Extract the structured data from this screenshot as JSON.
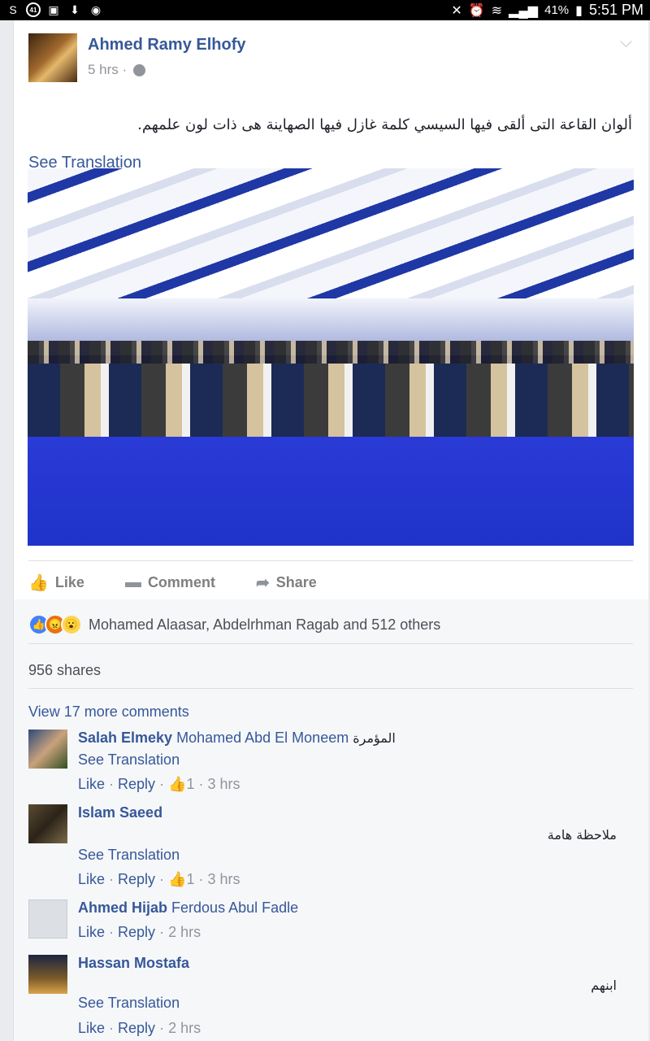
{
  "status_bar": {
    "left_icons": [
      "skype-icon",
      "notification-41-icon",
      "gallery-icon",
      "download-icon",
      "messenger-icon"
    ],
    "badge_text": "41",
    "battery": "41%",
    "time": "5:51 PM"
  },
  "post": {
    "author": "Ahmed Ramy Elhofy",
    "time": "5 hrs ·",
    "text": "ألوان القاعة التى ألقى فيها السيسي كلمة غازل فيها الصهاينة هى ذات لون علمهم.",
    "see_translation": "See Translation",
    "actions": {
      "like": "Like",
      "comment": "Comment",
      "share": "Share"
    }
  },
  "reactions": {
    "summary": "Mohamed Alaasar, Abdelrhman Ragab and 512 others",
    "shares": "956 shares",
    "view_more": "View 17 more comments"
  },
  "comments": [
    {
      "name": "Salah Elmeky",
      "tag": "Mohamed Abd El Moneem",
      "text_inline": "المؤمرة",
      "see_translation": "See Translation",
      "like": "Like",
      "reply": "Reply",
      "likes": "1",
      "time": "3 hrs"
    },
    {
      "name": "Islam Saeed",
      "text": "ملاحظة هامة",
      "see_translation": "See Translation",
      "like": "Like",
      "reply": "Reply",
      "likes": "1",
      "time": "3 hrs"
    },
    {
      "name": "Ahmed Hijab",
      "tag": "Ferdous Abul Fadle",
      "like": "Like",
      "reply": "Reply",
      "time": "2 hrs"
    },
    {
      "name": "Hassan Mostafa",
      "text": "ابنهم",
      "see_translation": "See Translation",
      "like": "Like",
      "reply": "Reply",
      "time": "2 hrs"
    }
  ],
  "colors": {
    "link": "#365899",
    "muted": "#90949c",
    "background": "#e9ebee",
    "like_reaction": "#4080ff",
    "angry_reaction": "#e9710f",
    "wow_reaction": "#fcd553"
  }
}
